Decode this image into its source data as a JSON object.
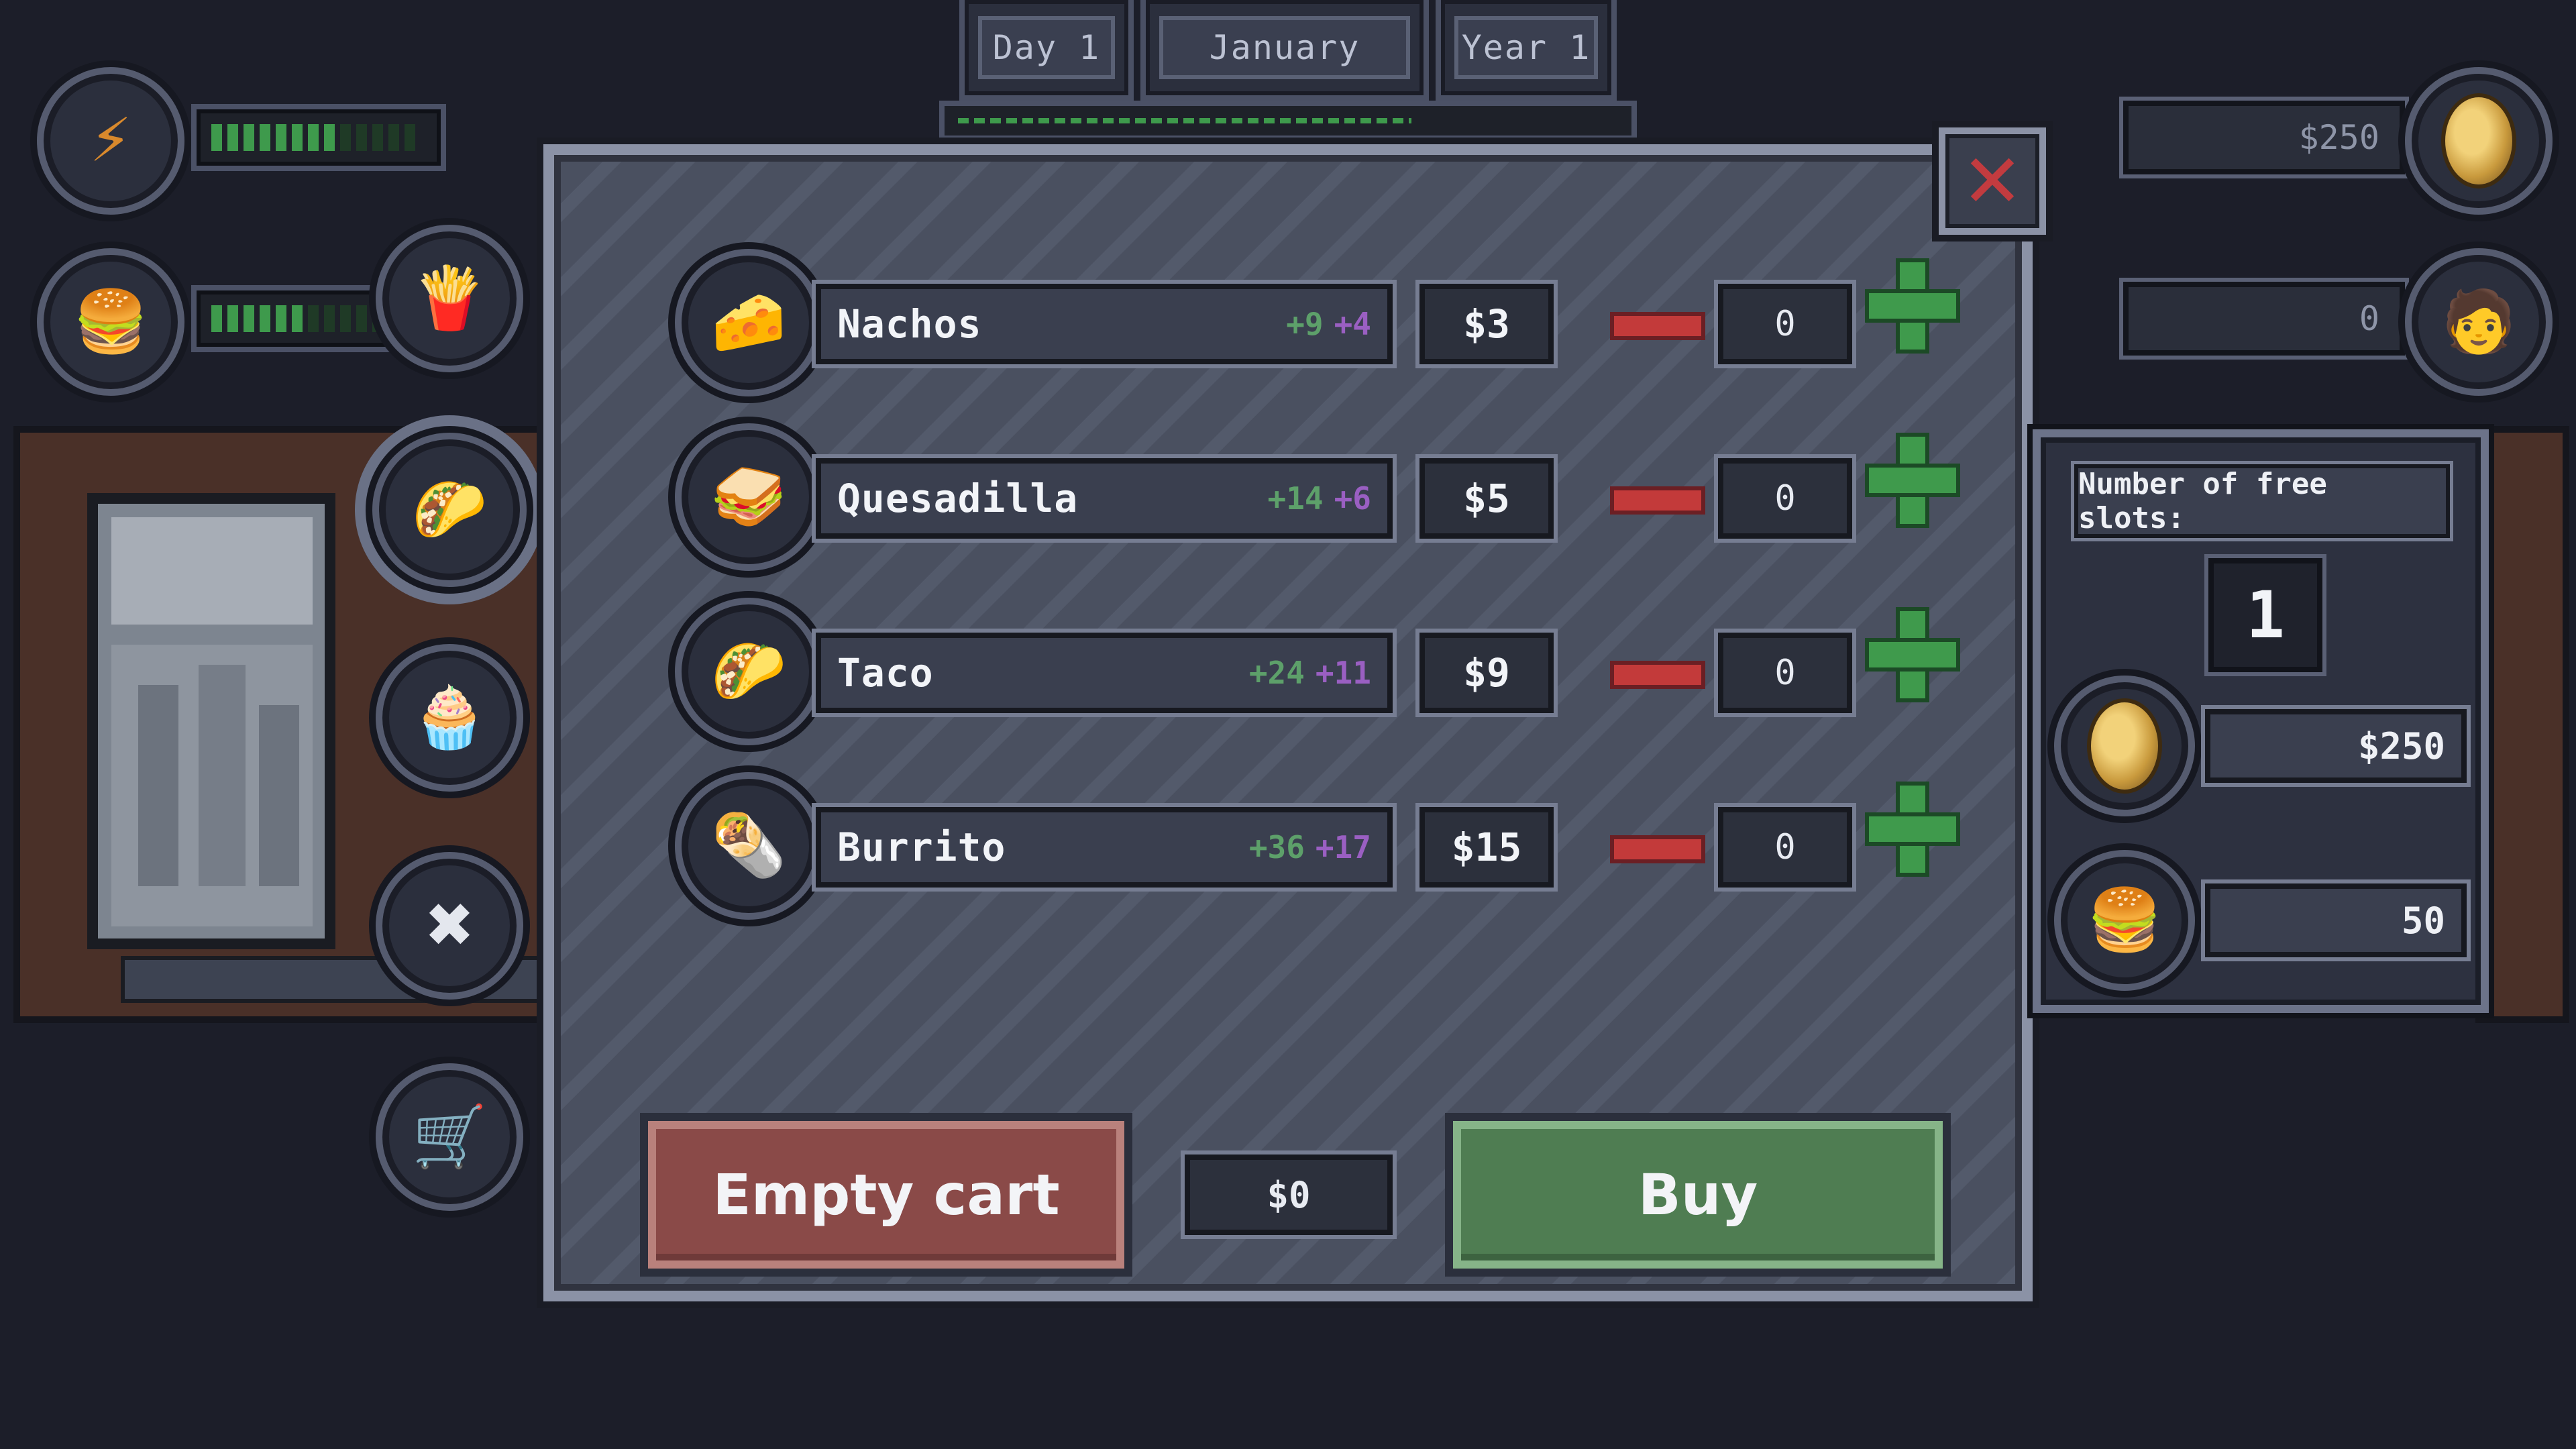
{
  "date": {
    "day": "Day 1",
    "month": "January",
    "year": "Year 1"
  },
  "status": {
    "energy_icon": "lightning-icon",
    "energy_level": 0.6,
    "food_level": 0.55
  },
  "top_right": {
    "money": "$250",
    "customers": "0"
  },
  "sidebar": [
    {
      "icon": "fries-icon"
    },
    {
      "icon": "tex-mex-icon"
    },
    {
      "icon": "dessert-icon"
    },
    {
      "icon": "tools-icon"
    },
    {
      "icon": "shopping-cart-icon"
    }
  ],
  "shop": {
    "items": [
      {
        "name": "Nachos",
        "stat_a": "+9",
        "stat_b": "+4",
        "price": "$3",
        "qty": "0",
        "icon": "nachos-icon"
      },
      {
        "name": "Quesadilla",
        "stat_a": "+14",
        "stat_b": "+6",
        "price": "$5",
        "qty": "0",
        "icon": "quesadilla-icon"
      },
      {
        "name": "Taco",
        "stat_a": "+24",
        "stat_b": "+11",
        "price": "$9",
        "qty": "0",
        "icon": "taco-icon"
      },
      {
        "name": "Burrito",
        "stat_a": "+36",
        "stat_b": "+17",
        "price": "$15",
        "qty": "0",
        "icon": "burrito-icon"
      }
    ],
    "empty_cart_label": "Empty cart",
    "total": "$0",
    "buy_label": "Buy",
    "close_glyph": "✕"
  },
  "slots_panel": {
    "label": "Number of free slots:",
    "free_slots": "1",
    "money": "$250",
    "food": "50"
  },
  "colors": {
    "stat_green": "#5da06a",
    "stat_purple": "#9a5fc2",
    "buy_green": "#4f7d52",
    "empty_red": "#8a4a48"
  }
}
